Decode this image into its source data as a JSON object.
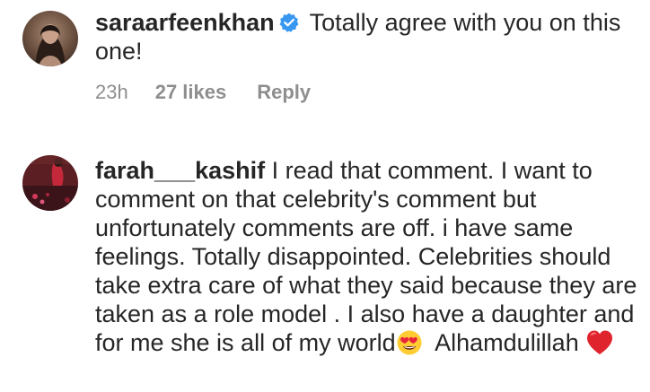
{
  "comments": [
    {
      "username": "saraarfeenkhan",
      "verified": true,
      "text": "Totally agree with you on this one!",
      "time": "23h",
      "likes": "27 likes",
      "reply": "Reply"
    },
    {
      "username": "farah___kashif",
      "verified": false,
      "text": "I read that comment. I want to comment on that celebrity's comment but unfortunately comments are off. i have same feelings. Totally disappointed. Celebrities should take extra care of what they said because they are taken as a role model . I also have a daughter and for me she is all of my world",
      "text_tail": "Alhamdulillah",
      "emojis": [
        "heart-eyes-emoji",
        "red-heart-emoji"
      ]
    }
  ],
  "colors": {
    "text": "#262626",
    "meta": "#8e8e8e",
    "verified_badge": "#3897f0"
  }
}
